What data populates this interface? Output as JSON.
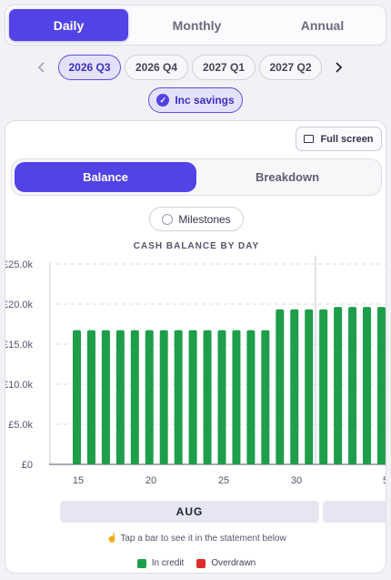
{
  "period_tabs": [
    {
      "label": "Daily",
      "active": true
    },
    {
      "label": "Monthly",
      "active": false
    },
    {
      "label": "Annual",
      "active": false
    }
  ],
  "quarters": [
    {
      "label": "2026 Q3",
      "active": true
    },
    {
      "label": "2026 Q4",
      "active": false
    },
    {
      "label": "2027 Q1",
      "active": false
    },
    {
      "label": "2027 Q2",
      "active": false
    }
  ],
  "nav": {
    "prev_icon": "chevron-left-icon",
    "next_icon": "chevron-right-icon"
  },
  "savings_toggle": {
    "label": "Inc savings",
    "checked": true
  },
  "card": {
    "fullscreen_label": "Full screen",
    "view_tabs": [
      {
        "label": "Balance",
        "active": true
      },
      {
        "label": "Breakdown",
        "active": false
      }
    ],
    "milestones_label": "Milestones",
    "month_label": "AUG",
    "hint": "Tap a bar to see it in the statement below"
  },
  "colors": {
    "accent": "#5243e6",
    "credit": "#1e9e4a",
    "overdrawn": "#e02b2b"
  },
  "chart_data": {
    "type": "bar",
    "title": "CASH BALANCE BY DAY",
    "x_tick_labels": [
      "15",
      "20",
      "25",
      "30",
      "5"
    ],
    "y_tick_labels": [
      "£0",
      "£5.0k",
      "£10.0k",
      "£15.0k",
      "£20.0k",
      "£25.0k"
    ],
    "ylim": [
      0,
      25000
    ],
    "grid": true,
    "legend": [
      {
        "name": "In credit",
        "color": "#1e9e4a"
      },
      {
        "name": "Overdrawn",
        "color": "#e02b2b"
      }
    ],
    "categories": [
      "16",
      "17",
      "18",
      "19",
      "20",
      "21",
      "22",
      "23",
      "24",
      "25",
      "26",
      "27",
      "28",
      "29",
      "30",
      "31",
      "1",
      "2",
      "3",
      "4",
      "5"
    ],
    "values": [
      16750,
      16750,
      16750,
      16750,
      16750,
      16750,
      16750,
      16750,
      16750,
      16750,
      16750,
      16750,
      16750,
      16750,
      19350,
      19350,
      19350,
      19350,
      19650,
      19650,
      19650,
      19650,
      19650
    ]
  }
}
